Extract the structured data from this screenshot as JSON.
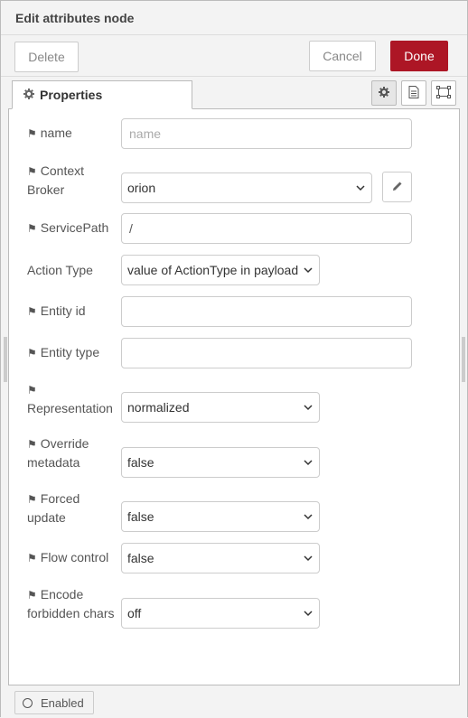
{
  "header": {
    "title": "Edit attributes node"
  },
  "toolbar": {
    "delete_label": "Delete",
    "cancel_label": "Cancel",
    "done_label": "Done"
  },
  "tabs": {
    "properties_label": "Properties"
  },
  "fields": {
    "name": {
      "label": "name",
      "placeholder": "name",
      "value": ""
    },
    "context_broker": {
      "label_line1": "Context",
      "label_line2": "Broker",
      "value": "orion"
    },
    "service_path": {
      "label": "ServicePath",
      "value": "/"
    },
    "action_type": {
      "label": "Action Type",
      "value": "value of ActionType in payload"
    },
    "entity_id": {
      "label": "Entity id",
      "value": ""
    },
    "entity_type": {
      "label": "Entity type",
      "value": ""
    },
    "representation": {
      "label": "Representation",
      "value": "normalized"
    },
    "override_metadata": {
      "label_line1": "Override",
      "label_line2": "metadata",
      "value": "false"
    },
    "forced_update": {
      "label_line1": "Forced",
      "label_line2": "update",
      "value": "false"
    },
    "flow_control": {
      "label": "Flow control",
      "value": "false"
    },
    "encode_forbidden": {
      "label_line1": "Encode",
      "label_line2": "forbidden chars",
      "value": "off"
    }
  },
  "footer": {
    "enabled_label": "Enabled"
  },
  "colors": {
    "done_button": "#ad1625",
    "background": "#f3f3f3"
  },
  "icons": [
    "gear-icon",
    "tag-icon",
    "pencil-icon",
    "document-icon",
    "frame-icon",
    "chevron-down-icon",
    "radio-icon"
  ]
}
